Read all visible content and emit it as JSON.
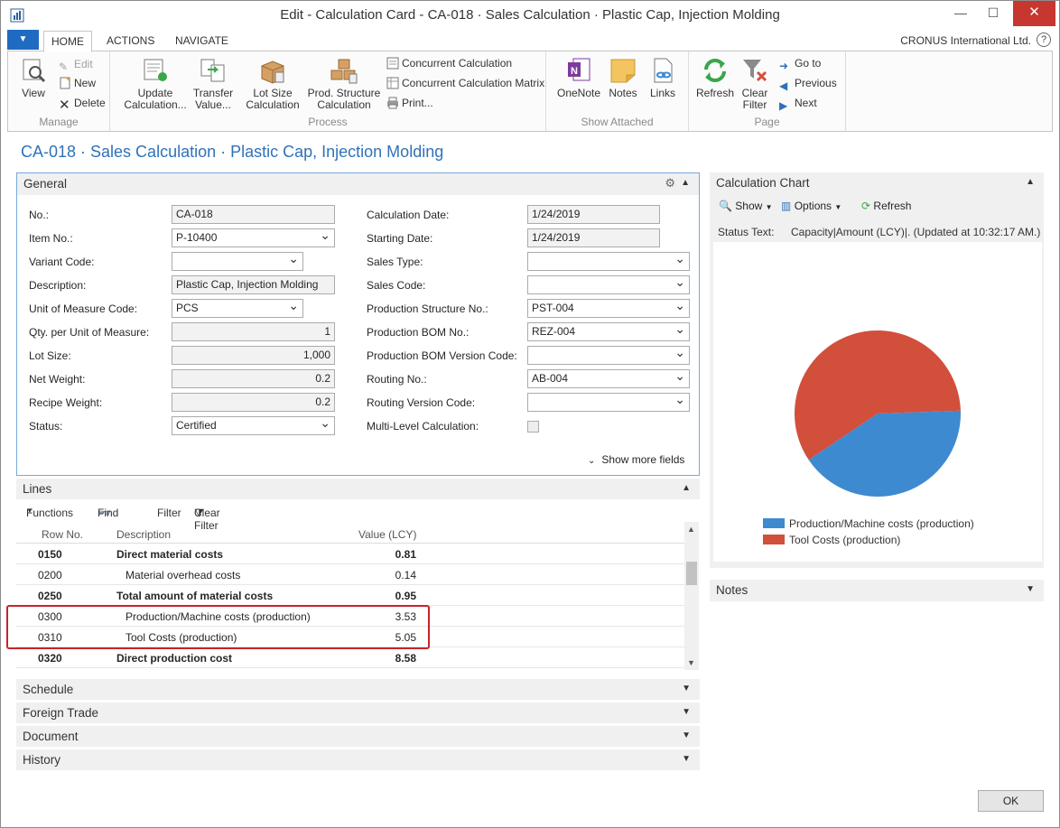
{
  "window": {
    "title": "Edit - Calculation Card - CA-018 · Sales Calculation · Plastic Cap, Injection Molding",
    "minimize": "—",
    "maximize": "☐",
    "close": "✕"
  },
  "ribbon": {
    "tabs": [
      "HOME",
      "ACTIONS",
      "NAVIGATE"
    ],
    "company": "CRONUS International Ltd.",
    "help": "?",
    "manage": {
      "label": "Manage",
      "view": "View",
      "edit": "Edit",
      "new": "New",
      "delete": "Delete"
    },
    "process": {
      "label": "Process",
      "update_calc": "Update Calculation...",
      "transfer_value": "Transfer Value...",
      "lot_size_calc": "Lot Size Calculation",
      "prod_structure_calc": "Prod. Structure Calculation",
      "concurrent_calc": "Concurrent Calculation",
      "concurrent_matrix": "Concurrent Calculation Matrix",
      "print": "Print..."
    },
    "show_attached": {
      "label": "Show Attached",
      "onenote": "OneNote",
      "notes": "Notes",
      "links": "Links"
    },
    "page": {
      "label": "Page",
      "refresh": "Refresh",
      "clear_filter": "Clear Filter",
      "go_to": "Go to",
      "previous": "Previous",
      "next": "Next"
    }
  },
  "page_title": "CA-018 · Sales Calculation · Plastic Cap, Injection Molding",
  "general": {
    "title": "General",
    "show_more": "Show more fields",
    "left_fields": [
      {
        "label": "No.:",
        "value": "CA-018"
      },
      {
        "label": "Item No.:",
        "value": "P-10400"
      },
      {
        "label": "Variant Code:",
        "value": ""
      },
      {
        "label": "Description:",
        "value": "Plastic Cap, Injection Molding"
      },
      {
        "label": "Unit of Measure Code:",
        "value": "PCS"
      },
      {
        "label": "Qty. per Unit of Measure:",
        "value": "1"
      },
      {
        "label": "Lot Size:",
        "value": "1,000"
      },
      {
        "label": "Net Weight:",
        "value": "0.2"
      },
      {
        "label": "Recipe Weight:",
        "value": "0.2"
      },
      {
        "label": "Status:",
        "value": "Certified"
      }
    ],
    "right_fields": [
      {
        "label": "Calculation Date:",
        "value": "1/24/2019"
      },
      {
        "label": "Starting Date:",
        "value": "1/24/2019"
      },
      {
        "label": "Sales Type:",
        "value": ""
      },
      {
        "label": "Sales Code:",
        "value": ""
      },
      {
        "label": "Production Structure No.:",
        "value": "PST-004"
      },
      {
        "label": "Production BOM No.:",
        "value": "REZ-004"
      },
      {
        "label": "Production BOM Version Code:",
        "value": ""
      },
      {
        "label": "Routing No.:",
        "value": "AB-004"
      },
      {
        "label": "Routing Version Code:",
        "value": ""
      },
      {
        "label": "Multi-Level Calculation:",
        "value": ""
      }
    ]
  },
  "lines": {
    "title": "Lines",
    "toolbar": {
      "functions": "Functions",
      "find": "Find",
      "filter": "Filter",
      "clear_filter": "Clear Filter"
    },
    "columns": [
      "Row No.",
      "Description",
      "Value (LCY)"
    ],
    "rows": [
      {
        "row": "0150",
        "desc": "Direct material costs",
        "value": "0.81"
      },
      {
        "row": "0200",
        "desc": "Material overhead costs",
        "value": "0.14"
      },
      {
        "row": "0250",
        "desc": "Total amount of material costs",
        "value": "0.95"
      },
      {
        "row": "0300",
        "desc": "Production/Machine costs (production)",
        "value": "3.53"
      },
      {
        "row": "0310",
        "desc": "Tool Costs (production)",
        "value": "5.05"
      },
      {
        "row": "0320",
        "desc": "Direct production cost",
        "value": "8.58"
      }
    ]
  },
  "collapsed_tabs": [
    "Schedule",
    "Foreign Trade",
    "Document",
    "History"
  ],
  "chart_panel": {
    "title": "Calculation Chart",
    "show": "Show",
    "options": "Options",
    "refresh": "Refresh",
    "status_label": "Status Text:",
    "status_value": "Capacity|Amount (LCY)|. (Updated at 10:32:17 AM.)"
  },
  "chart_data": {
    "type": "pie",
    "categories": [
      "Production/Machine costs (production)",
      "Tool Costs (production)"
    ],
    "values": [
      3.53,
      5.05
    ],
    "colors": [
      "#3e8ad0",
      "#d24f3c"
    ],
    "title": "",
    "legend": "bottom"
  },
  "notes_panel": {
    "title": "Notes"
  },
  "ok_button": "OK"
}
